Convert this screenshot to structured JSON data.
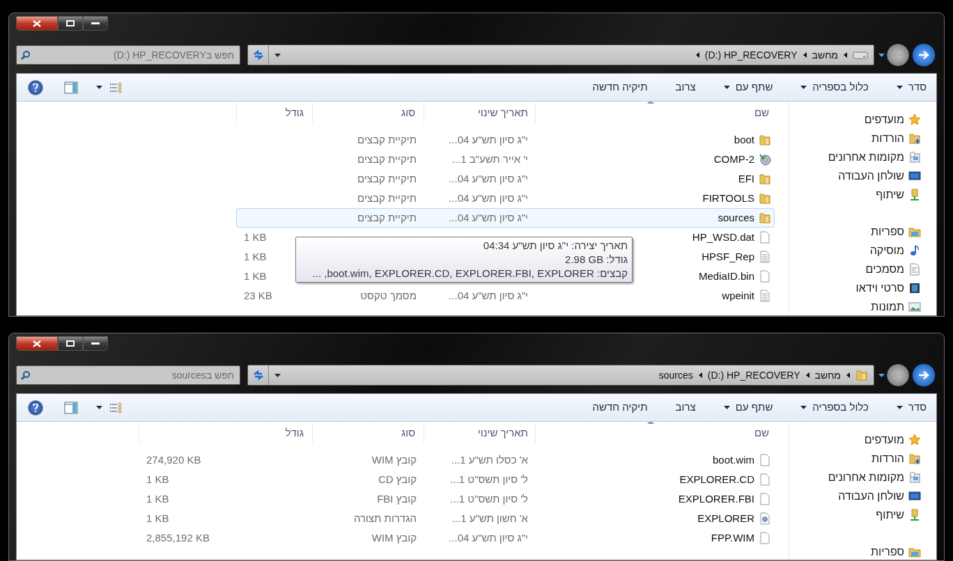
{
  "windows": [
    {
      "search": {
        "placeholder": "(D:) HP_RECOVERYחפש ב"
      },
      "address": {
        "kind": "drive",
        "crumbs": [
          {
            "label": "מחשב",
            "chevron": true
          },
          {
            "label": "(D:) HP_RECOVERY",
            "chevron": true
          }
        ]
      },
      "toolbar": [
        {
          "label": "סדר",
          "dropdown": true
        },
        {
          "label": "כלול בספריה",
          "dropdown": true
        },
        {
          "label": "שתף עם",
          "dropdown": true
        },
        {
          "label": "צרוב",
          "dropdown": false
        },
        {
          "label": "תיקיה חדשה",
          "dropdown": false
        }
      ],
      "columns": [
        "שם",
        "תאריך שינוי",
        "סוג",
        "גודל"
      ],
      "rows": [
        {
          "name": "boot",
          "kind": "folder",
          "date": "י\"ג סיון תש\"ע 04...",
          "type": "תיקיית קבצים",
          "selected": false
        },
        {
          "name": "COMP-2",
          "kind": "disc",
          "date": "י' אייר תשע\"ב 1...",
          "type": "תיקיית קבצים",
          "selected": false
        },
        {
          "name": "EFI",
          "kind": "folder",
          "date": "י\"ג סיון תש\"ע 04...",
          "type": "תיקיית קבצים",
          "selected": false
        },
        {
          "name": "FIRTOOLS",
          "kind": "folder",
          "date": "י\"ג סיון תש\"ע 04...",
          "type": "תיקיית קבצים",
          "selected": false
        },
        {
          "name": "sources",
          "kind": "folder",
          "date": "י\"ג סיון תש\"ע 04...",
          "type": "תיקיית קבצים",
          "selected": true
        },
        {
          "name": "HP_WSD.dat",
          "kind": "file",
          "size": "1 KB",
          "selected": false
        },
        {
          "name": "HPSF_Rep",
          "kind": "text",
          "size": "1 KB",
          "selected": false
        },
        {
          "name": "MediaID.bin",
          "kind": "file",
          "size": "1 KB",
          "selected": false
        },
        {
          "name": "wpeinit",
          "kind": "text",
          "date": "י\"ג סיון תש\"ע 04...",
          "type": "מסמך טקסט",
          "size": "23 KB",
          "selected": false
        }
      ],
      "tooltip": [
        {
          "kind": "text",
          "text": "תאריך יצירה: י\"ג סיון תש\"ע 04:34"
        },
        {
          "kind": "size",
          "label": "גודל:",
          "value": "2.98 GB"
        },
        {
          "kind": "text",
          "text": "קבצים: boot.wim, EXPLORER.CD, EXPLORER.FBI, EXPLORER, ..."
        }
      ],
      "sidebar": [
        {
          "items": [
            {
              "label": "מועדפים",
              "kind": "star"
            },
            {
              "label": "הורדות",
              "kind": "downloads"
            },
            {
              "label": "מקומות אחרונים",
              "kind": "recent"
            },
            {
              "label": "שולחן העבודה",
              "kind": "desktop"
            },
            {
              "label": "שיתוף",
              "kind": "share"
            }
          ]
        },
        {
          "items": [
            {
              "label": "ספריות",
              "kind": "library"
            },
            {
              "label": "מוסיקה",
              "kind": "music"
            },
            {
              "label": "מסמכים",
              "kind": "documents"
            },
            {
              "label": "סרטי וידאו",
              "kind": "videos"
            },
            {
              "label": "תמונות",
              "kind": "pictures"
            }
          ]
        }
      ]
    },
    {
      "search": {
        "placeholder": "sourcesחפש ב"
      },
      "address": {
        "kind": "folder",
        "crumbs": [
          {
            "label": "מחשב",
            "chevron": true
          },
          {
            "label": "(D:) HP_RECOVERY",
            "chevron": true
          },
          {
            "label": "sources",
            "chevron": false
          }
        ]
      },
      "toolbar": [
        {
          "label": "סדר",
          "dropdown": true
        },
        {
          "label": "כלול בספריה",
          "dropdown": true
        },
        {
          "label": "שתף עם",
          "dropdown": true
        },
        {
          "label": "צרוב",
          "dropdown": false
        },
        {
          "label": "תיקיה חדשה",
          "dropdown": false
        }
      ],
      "columns": [
        "שם",
        "תאריך שינוי",
        "סוג",
        "גודל"
      ],
      "rows": [
        {
          "name": "boot.wim",
          "kind": "file",
          "date": "א' כסלו תש\"ע 1...",
          "type": "קובץ WIM",
          "size": "274,920 KB",
          "selected": false
        },
        {
          "name": "EXPLORER.CD",
          "kind": "file",
          "date": "ל' סיון תשס\"ט 1...",
          "type": "קובץ CD",
          "size": "1 KB",
          "selected": false
        },
        {
          "name": "EXPLORER.FBI",
          "kind": "file",
          "date": "ל' סיון תשס\"ט 1...",
          "type": "קובץ FBI",
          "size": "1 KB",
          "selected": false
        },
        {
          "name": "EXPLORER",
          "kind": "settings",
          "date": "א' חשון תש\"ע 1...",
          "type": "הגדרות תצורה",
          "size": "1 KB",
          "selected": false
        },
        {
          "name": "FPP.WIM",
          "kind": "file",
          "date": "י\"ג סיון תש\"ע 04...",
          "type": "קובץ WIM",
          "size": "2,855,192 KB",
          "selected": false
        }
      ],
      "sidebar": [
        {
          "items": [
            {
              "label": "מועדפים",
              "kind": "star"
            },
            {
              "label": "הורדות",
              "kind": "downloads"
            },
            {
              "label": "מקומות אחרונים",
              "kind": "recent"
            },
            {
              "label": "שולחן העבודה",
              "kind": "desktop"
            },
            {
              "label": "שיתוף",
              "kind": "share"
            }
          ]
        },
        {
          "items": [
            {
              "label": "ספריות",
              "kind": "library"
            }
          ]
        }
      ]
    }
  ]
}
